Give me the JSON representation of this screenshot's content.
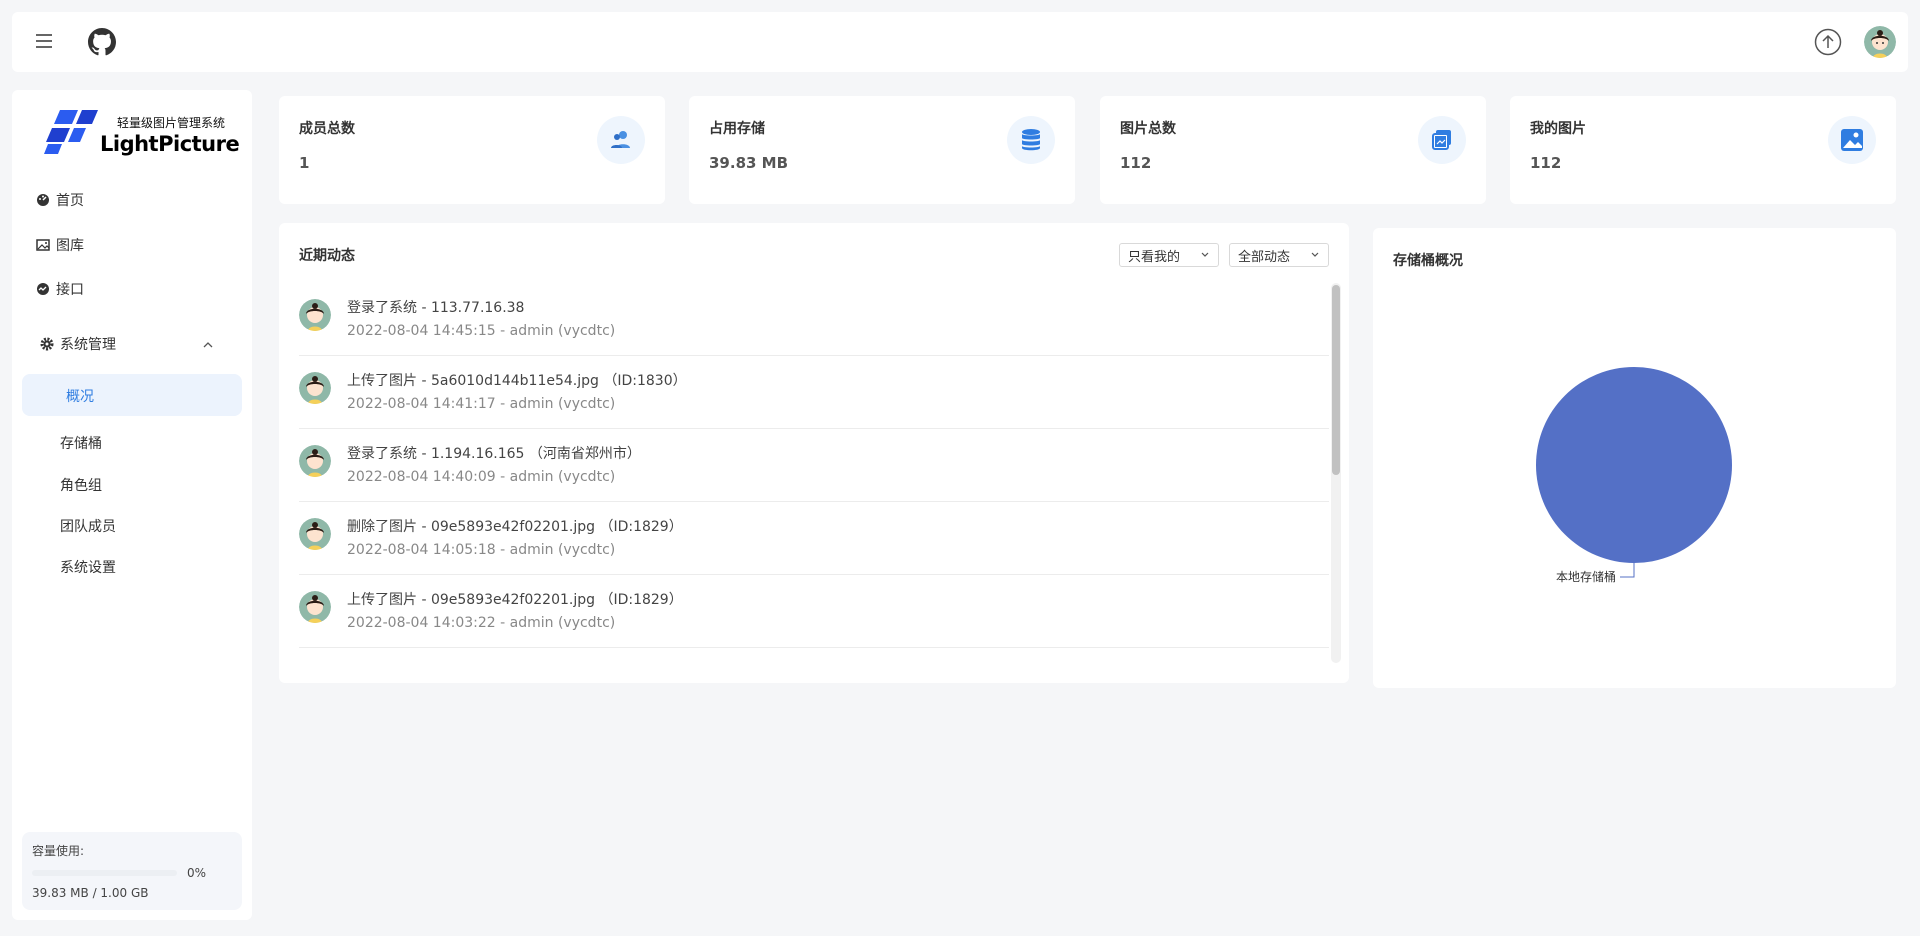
{
  "header": {
    "menu_icon": "hamburger-icon",
    "github_icon": "github-icon",
    "upload_icon": "upload-icon"
  },
  "sidebar": {
    "logo_subtitle": "轻量级图片管理系统",
    "logo_name": "LightPicture",
    "nav": [
      {
        "label": "首页",
        "icon": "dashboard-icon"
      },
      {
        "label": "图库",
        "icon": "image-icon"
      },
      {
        "label": "接口",
        "icon": "api-icon"
      }
    ],
    "system_group": {
      "label": "系统管理",
      "icon": "gear-icon"
    },
    "sub_items": [
      "概况",
      "存储桶",
      "角色组",
      "团队成员",
      "系统设置"
    ],
    "capacity": {
      "label": "容量使用:",
      "percent_text": "0%",
      "percent": 0,
      "used_text": "39.83 MB / 1.00 GB"
    }
  },
  "stats": [
    {
      "label": "成员总数",
      "value": "1",
      "icon": "users-icon"
    },
    {
      "label": "占用存储",
      "value": "39.83 MB",
      "icon": "database-icon"
    },
    {
      "label": "图片总数",
      "value": "112",
      "icon": "images-icon"
    },
    {
      "label": "我的图片",
      "value": "112",
      "icon": "picture-icon"
    }
  ],
  "activity": {
    "title": "近期动态",
    "filter_mine": "只看我的",
    "filter_all": "全部动态",
    "items": [
      {
        "text": "登录了系统 - 113.77.16.38",
        "meta": "2022-08-04 14:45:15 - admin (vycdtc)"
      },
      {
        "text": "上传了图片 - 5a6010d144b11e54.jpg （ID:1830）",
        "meta": "2022-08-04 14:41:17 - admin (vycdtc)"
      },
      {
        "text": "登录了系统 - 1.194.16.165 （河南省郑州市）",
        "meta": "2022-08-04 14:40:09 - admin (vycdtc)"
      },
      {
        "text": "删除了图片 - 09e5893e42f02201.jpg （ID:1829）",
        "meta": "2022-08-04 14:05:18 - admin (vycdtc)"
      },
      {
        "text": "上传了图片 - 09e5893e42f02201.jpg （ID:1829）",
        "meta": "2022-08-04 14:03:22 - admin (vycdtc)"
      }
    ]
  },
  "storage": {
    "title": "存储桶概况",
    "chart_data": {
      "type": "pie",
      "categories": [
        "本地存储桶"
      ],
      "values": [
        100
      ],
      "colors": [
        "#5470c6"
      ]
    }
  },
  "colors": {
    "accent": "#2f7de1",
    "pie": "#5470c6"
  }
}
